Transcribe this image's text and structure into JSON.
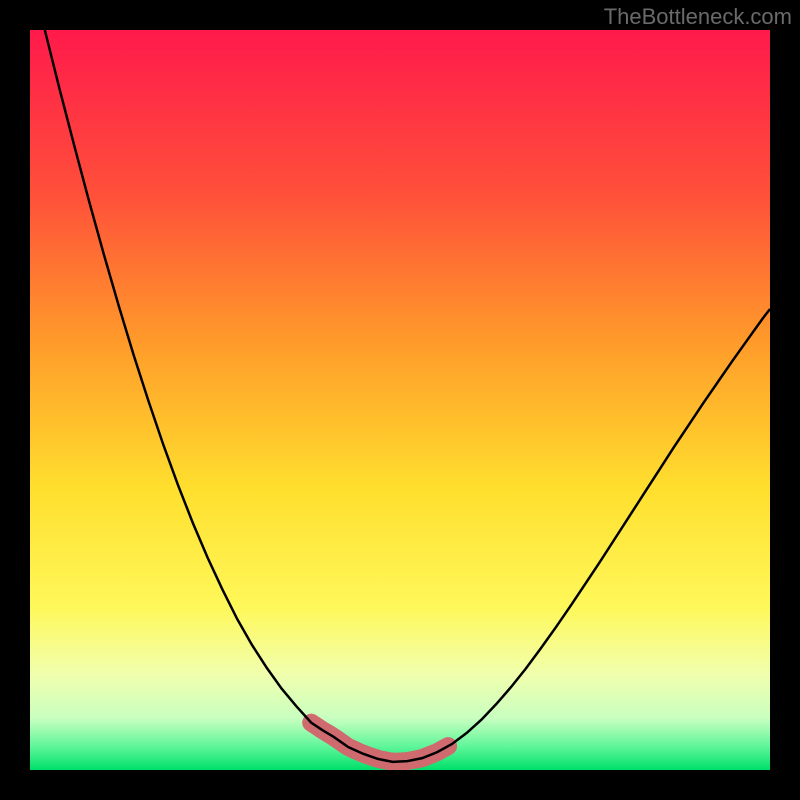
{
  "watermark": "TheBottleneck.com",
  "colors": {
    "frame": "#000000",
    "curve": "#000000",
    "highlight": "#cf6a6f",
    "gradient_top": "#ff1a4b",
    "gradient_mid_warm": "#ff8a2a",
    "gradient_mid": "#ffe92e",
    "gradient_low": "#f2ffb0",
    "gradient_bottom": "#00e06a"
  },
  "chart_data": {
    "type": "line",
    "title": "",
    "xlabel": "",
    "ylabel": "",
    "xlim": [
      0,
      100
    ],
    "ylim": [
      0,
      100
    ],
    "x": [
      2,
      4,
      6,
      8,
      10,
      12,
      14,
      16,
      18,
      20,
      22,
      24,
      26,
      28,
      30,
      32,
      34,
      36,
      38,
      39.5,
      41,
      43,
      45,
      47,
      49,
      51,
      53,
      55,
      57,
      59,
      61,
      63,
      65,
      67,
      69,
      71,
      73,
      75,
      77,
      79,
      81,
      83,
      85,
      87,
      89,
      91,
      93,
      95,
      97,
      99,
      100
    ],
    "y": [
      100,
      92,
      84.3,
      76.8,
      69.6,
      62.7,
      56.1,
      49.9,
      44,
      38.5,
      33.4,
      28.7,
      24.4,
      20.4,
      16.9,
      13.8,
      11,
      8.6,
      6.4,
      5.4,
      4.5,
      3.1,
      2.2,
      1.5,
      1.1,
      1.2,
      1.6,
      2.4,
      3.5,
      5,
      6.8,
      8.9,
      11.2,
      13.7,
      16.4,
      19.2,
      22.1,
      25.1,
      28.1,
      31.2,
      34.3,
      37.4,
      40.5,
      43.6,
      46.6,
      49.6,
      52.5,
      55.4,
      58.2,
      61,
      62.3
    ],
    "highlight_regions": [
      {
        "x_range": [
          38,
          42.5
        ]
      },
      {
        "x_range": [
          52,
          56.5
        ]
      }
    ],
    "highlight_floor_x_range": [
      40,
      54.5
    ],
    "highlight_style": {
      "stroke_width": 18,
      "cap": "round"
    }
  }
}
